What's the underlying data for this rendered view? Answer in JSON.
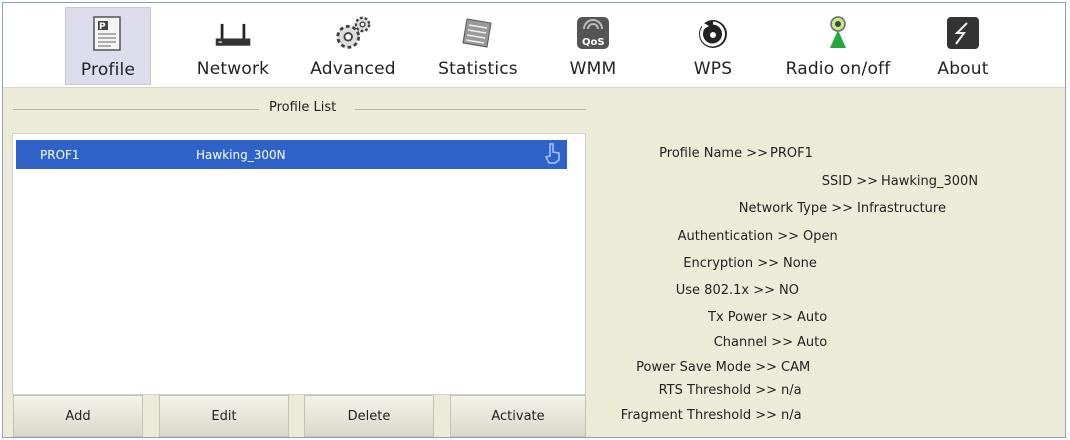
{
  "toolbar": {
    "items": [
      {
        "id": "profile",
        "label": "Profile",
        "icon": "profile-icon",
        "active": true
      },
      {
        "id": "network",
        "label": "Network",
        "icon": "router-icon"
      },
      {
        "id": "advanced",
        "label": "Advanced",
        "icon": "gear-icon"
      },
      {
        "id": "statistics",
        "label": "Statistics",
        "icon": "statistics-icon"
      },
      {
        "id": "wmm",
        "label": "WMM",
        "icon": "qos-icon"
      },
      {
        "id": "wps",
        "label": "WPS",
        "icon": "wps-icon"
      },
      {
        "id": "radio",
        "label": "Radio on/off",
        "icon": "radio-icon"
      },
      {
        "id": "about",
        "label": "About",
        "icon": "about-icon"
      }
    ],
    "icon_labels": {
      "qos": "QoS"
    }
  },
  "profile_list": {
    "title": "Profile List",
    "rows": [
      {
        "name": "PROF1",
        "ssid": "Hawking_300N",
        "selected": true,
        "icon": "hand-pointer-icon"
      }
    ]
  },
  "buttons": {
    "add": "Add",
    "edit": "Edit",
    "delete": "Delete",
    "activate": "Activate"
  },
  "details": [
    {
      "label": "Profile Name >>",
      "value": "PROF1"
    },
    {
      "label": "SSID >>",
      "value": "Hawking_300N"
    },
    {
      "label": "Network Type >>",
      "value": "Infrastructure"
    },
    {
      "label": "Authentication >>",
      "value": "Open"
    },
    {
      "label": "Encryption >>",
      "value": "None"
    },
    {
      "label": "Use 802.1x >>",
      "value": "NO"
    },
    {
      "label": "Tx Power >>",
      "value": "Auto"
    },
    {
      "label": "Channel >>",
      "value": "Auto"
    },
    {
      "label": "Power Save Mode >>",
      "value": "CAM"
    },
    {
      "label": "RTS Threshold >>",
      "value": "n/a"
    },
    {
      "label": "Fragment Threshold >>",
      "value": "n/a"
    }
  ],
  "colors": {
    "selection": "#2f62c8",
    "panel": "#ecebd8",
    "toolbar": "#ffffff"
  }
}
